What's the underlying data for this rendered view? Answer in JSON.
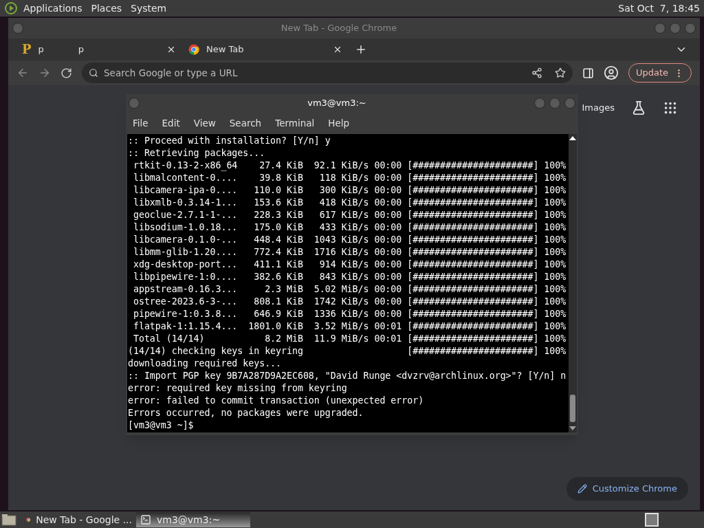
{
  "top_panel": {
    "menus": [
      "Applications",
      "Places",
      "System"
    ],
    "clock": "Sat Oct  7, 18:45"
  },
  "chrome": {
    "title": "New Tab - Google Chrome",
    "tabs": [
      {
        "kind": "site",
        "favicon_text": "P",
        "labels": [
          "p",
          "p"
        ]
      },
      {
        "kind": "chrome",
        "labels": [
          "New Tab"
        ]
      }
    ],
    "omnibox": {
      "placeholder": "Search Google or type a URL"
    },
    "update_button": "Update",
    "content": {
      "links": [
        "Images"
      ],
      "customize_button": "Customize Chrome"
    }
  },
  "terminal": {
    "title": "vm3@vm3:~",
    "menus": [
      "File",
      "Edit",
      "View",
      "Search",
      "Terminal",
      "Help"
    ],
    "lines": [
      ":: Proceed with installation? [Y/n] y",
      ":: Retrieving packages...",
      " rtkit-0.13-2-x86_64    27.4 KiB  92.1 KiB/s 00:00 [######################] 100%",
      " libmalcontent-0....    39.8 KiB   118 KiB/s 00:00 [######################] 100%",
      " libcamera-ipa-0....   110.0 KiB   300 KiB/s 00:00 [######################] 100%",
      " libxmlb-0.3.14-1...   153.6 KiB   418 KiB/s 00:00 [######################] 100%",
      " geoclue-2.7.1-1-...   228.3 KiB   617 KiB/s 00:00 [######################] 100%",
      " libsodium-1.0.18...   175.0 KiB   433 KiB/s 00:00 [######################] 100%",
      " libcamera-0.1.0-...   448.4 KiB  1043 KiB/s 00:00 [######################] 100%",
      " libmm-glib-1.20....   772.4 KiB  1716 KiB/s 00:00 [######################] 100%",
      " xdg-desktop-port...   411.1 KiB   914 KiB/s 00:00 [######################] 100%",
      " libpipewire-1:0....   382.6 KiB   843 KiB/s 00:00 [######################] 100%",
      " appstream-0.16.3...     2.3 MiB  5.02 MiB/s 00:00 [######################] 100%",
      " ostree-2023.6-3-...   808.1 KiB  1742 KiB/s 00:00 [######################] 100%",
      " pipewire-1:0.3.8...   646.9 KiB  1336 KiB/s 00:00 [######################] 100%",
      " flatpak-1:1.15.4...  1801.0 KiB  3.52 MiB/s 00:01 [######################] 100%",
      " Total (14/14)           8.2 MiB  11.9 MiB/s 00:01 [######################] 100%",
      "(14/14) checking keys in keyring                   [######################] 100%",
      "downloading required keys...",
      ":: Import PGP key 9B7A287D9A2EC608, \"David Runge <dvzrv@archlinux.org>\"? [Y/n] n",
      "error: required key missing from keyring",
      "error: failed to commit transaction (unexpected error)",
      "Errors occurred, no packages were upgraded.",
      "[vm3@vm3 ~]$"
    ]
  },
  "taskbar": {
    "items": [
      {
        "kind": "chrome",
        "label": "New Tab - Google ...",
        "selected": false
      },
      {
        "kind": "terminal",
        "label": "vm3@vm3:~",
        "selected": true
      }
    ]
  }
}
